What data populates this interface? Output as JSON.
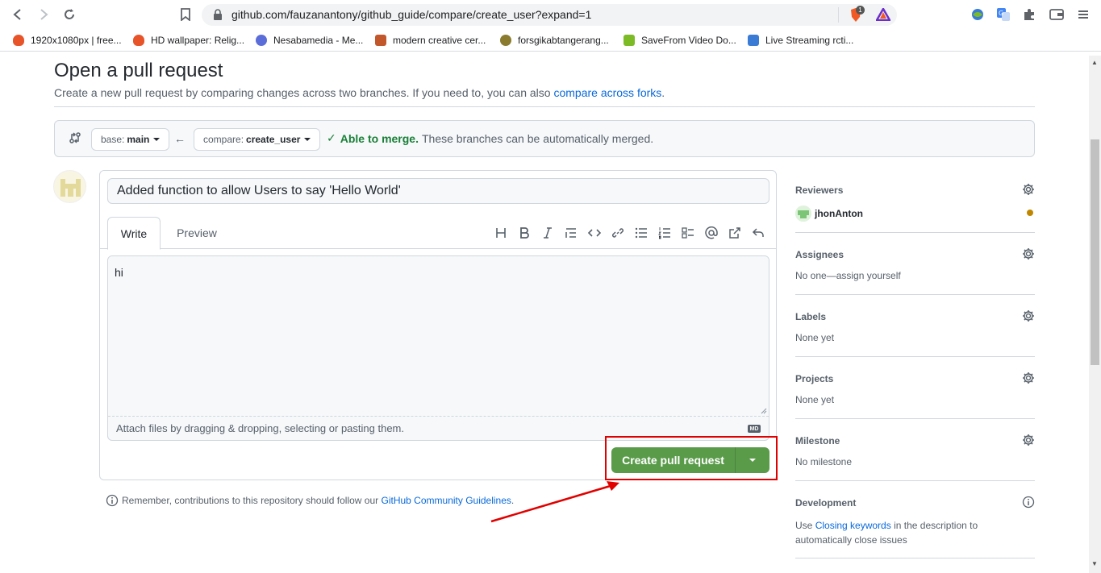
{
  "browser": {
    "url": "github.com/fauzanantony/github_guide/compare/create_user?expand=1",
    "brave_badge": "1",
    "bookmarks": [
      {
        "label": "1920x1080px | free...",
        "color": "#e8542a"
      },
      {
        "label": "HD wallpaper: Relig...",
        "color": "#e8542a"
      },
      {
        "label": "Nesabamedia - Me...",
        "color": "#5b6dd8"
      },
      {
        "label": "modern creative cer...",
        "color": "#c2572c"
      },
      {
        "label": "forsgikabtangerang...",
        "color": "#8a7b2f"
      },
      {
        "label": "SaveFrom Video Do...",
        "color": "#7dbb26"
      },
      {
        "label": "Live Streaming rcti...",
        "color": "#3a7bd5"
      }
    ]
  },
  "page": {
    "title": "Open a pull request",
    "description_prefix": "Create a new pull request by comparing changes across two branches. If you need to, you can also",
    "description_link": "compare across forks",
    "description_suffix": "."
  },
  "range": {
    "base_label": "base:",
    "base_value": "main",
    "compare_label": "compare:",
    "compare_value": "create_user",
    "merge_ok": "Able to merge.",
    "merge_text": "These branches can be automatically merged."
  },
  "composer": {
    "title_value": "Added function to allow Users to say 'Hello World'",
    "tab_write": "Write",
    "tab_preview": "Preview",
    "body_value": "hi",
    "attach_text": "Attach files by dragging & dropping, selecting or pasting them.",
    "md_badge": "MD",
    "submit_label": "Create pull request"
  },
  "reminder": {
    "prefix": "Remember, contributions to this repository should follow our",
    "link": "GitHub Community Guidelines",
    "suffix": "."
  },
  "sidebar": {
    "reviewers_title": "Reviewers",
    "reviewer_name": "jhonAnton",
    "assignees_title": "Assignees",
    "assignees_value": "No one—assign yourself",
    "labels_title": "Labels",
    "labels_value": "None yet",
    "projects_title": "Projects",
    "projects_value": "None yet",
    "milestone_title": "Milestone",
    "milestone_value": "No milestone",
    "development_title": "Development",
    "development_prefix": "Use",
    "development_link": "Closing keywords",
    "development_suffix": "in the description to automatically close issues"
  },
  "colors": {
    "accent_link": "#0969da",
    "merge_green": "#1a7f37",
    "button_green": "#5a9b4a",
    "annotation_red": "#e00000"
  }
}
